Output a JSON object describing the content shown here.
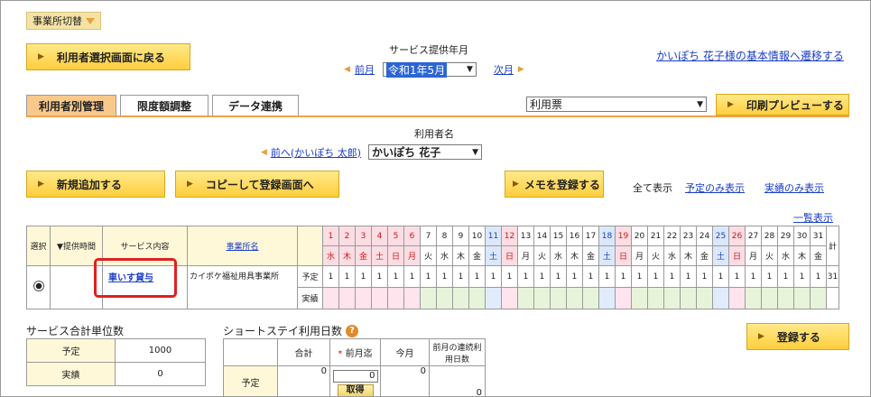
{
  "jigyosho_switch": "事業所切替",
  "back_button": "利用者選択画面に戻る",
  "service_month_label": "サービス提供年月",
  "prev_month": "前月",
  "month_value": "令和1年5月",
  "next_month": "次月",
  "user_info_link": "かいぽち 花子様の基本情報へ遷移する",
  "tabs": [
    "利用者別管理",
    "限度額調整",
    "データ連携"
  ],
  "report_select": "利用票",
  "print_preview_button": "印刷プレビューする",
  "user_name_label": "利用者名",
  "prev_user_link": "前へ(かいぽち 太郎)",
  "user_select": "かいぽち 花子",
  "add_button": "新規追加する",
  "copy_button": "コピーして登録画面へ",
  "memo_button": "メモを登録する",
  "view_filters": {
    "all": "全て表示",
    "planned_only": "予定のみ表示",
    "actual_only": "実績のみ表示"
  },
  "list_link": "一覧表示",
  "schedule": {
    "headers": {
      "select": "選択",
      "time": "▼提供時間",
      "service": "サービス内容",
      "office": "事業所名",
      "total": "計"
    },
    "days": [
      "1",
      "2",
      "3",
      "4",
      "5",
      "6",
      "7",
      "8",
      "9",
      "10",
      "11",
      "12",
      "13",
      "14",
      "15",
      "16",
      "17",
      "18",
      "19",
      "20",
      "21",
      "22",
      "23",
      "24",
      "25",
      "26",
      "27",
      "28",
      "29",
      "30",
      "31"
    ],
    "weekdays": [
      "水",
      "木",
      "金",
      "土",
      "日",
      "月",
      "火",
      "水",
      "木",
      "金",
      "土",
      "日",
      "月",
      "火",
      "水",
      "木",
      "金",
      "土",
      "日",
      "月",
      "火",
      "水",
      "木",
      "金",
      "土",
      "日",
      "月",
      "火",
      "水",
      "木",
      "金"
    ],
    "row": {
      "service": "車いす貸与",
      "office": "カイポケ福祉用具事業所",
      "plan_label": "予定",
      "actual_label": "実績",
      "plan_values": [
        "1",
        "1",
        "1",
        "1",
        "1",
        "1",
        "1",
        "1",
        "1",
        "1",
        "1",
        "1",
        "1",
        "1",
        "1",
        "1",
        "1",
        "1",
        "1",
        "1",
        "1",
        "1",
        "1",
        "1",
        "1",
        "1",
        "1",
        "1",
        "1",
        "1",
        "1"
      ],
      "plan_total": "31"
    }
  },
  "service_units": {
    "title": "サービス合計単位数",
    "plan_label": "予定",
    "plan_value": "1000",
    "actual_label": "実績",
    "actual_value": "0"
  },
  "shortstay": {
    "title": "ショートステイ利用日数",
    "help": "?",
    "cols": [
      "合計",
      "前月迄",
      "今月",
      "前月の連続利用日数"
    ],
    "required_mark": "*",
    "row_label": "予定",
    "values": [
      "0",
      "0",
      "0",
      "0"
    ],
    "fetch_button": "取得"
  },
  "register_button": "登録する"
}
